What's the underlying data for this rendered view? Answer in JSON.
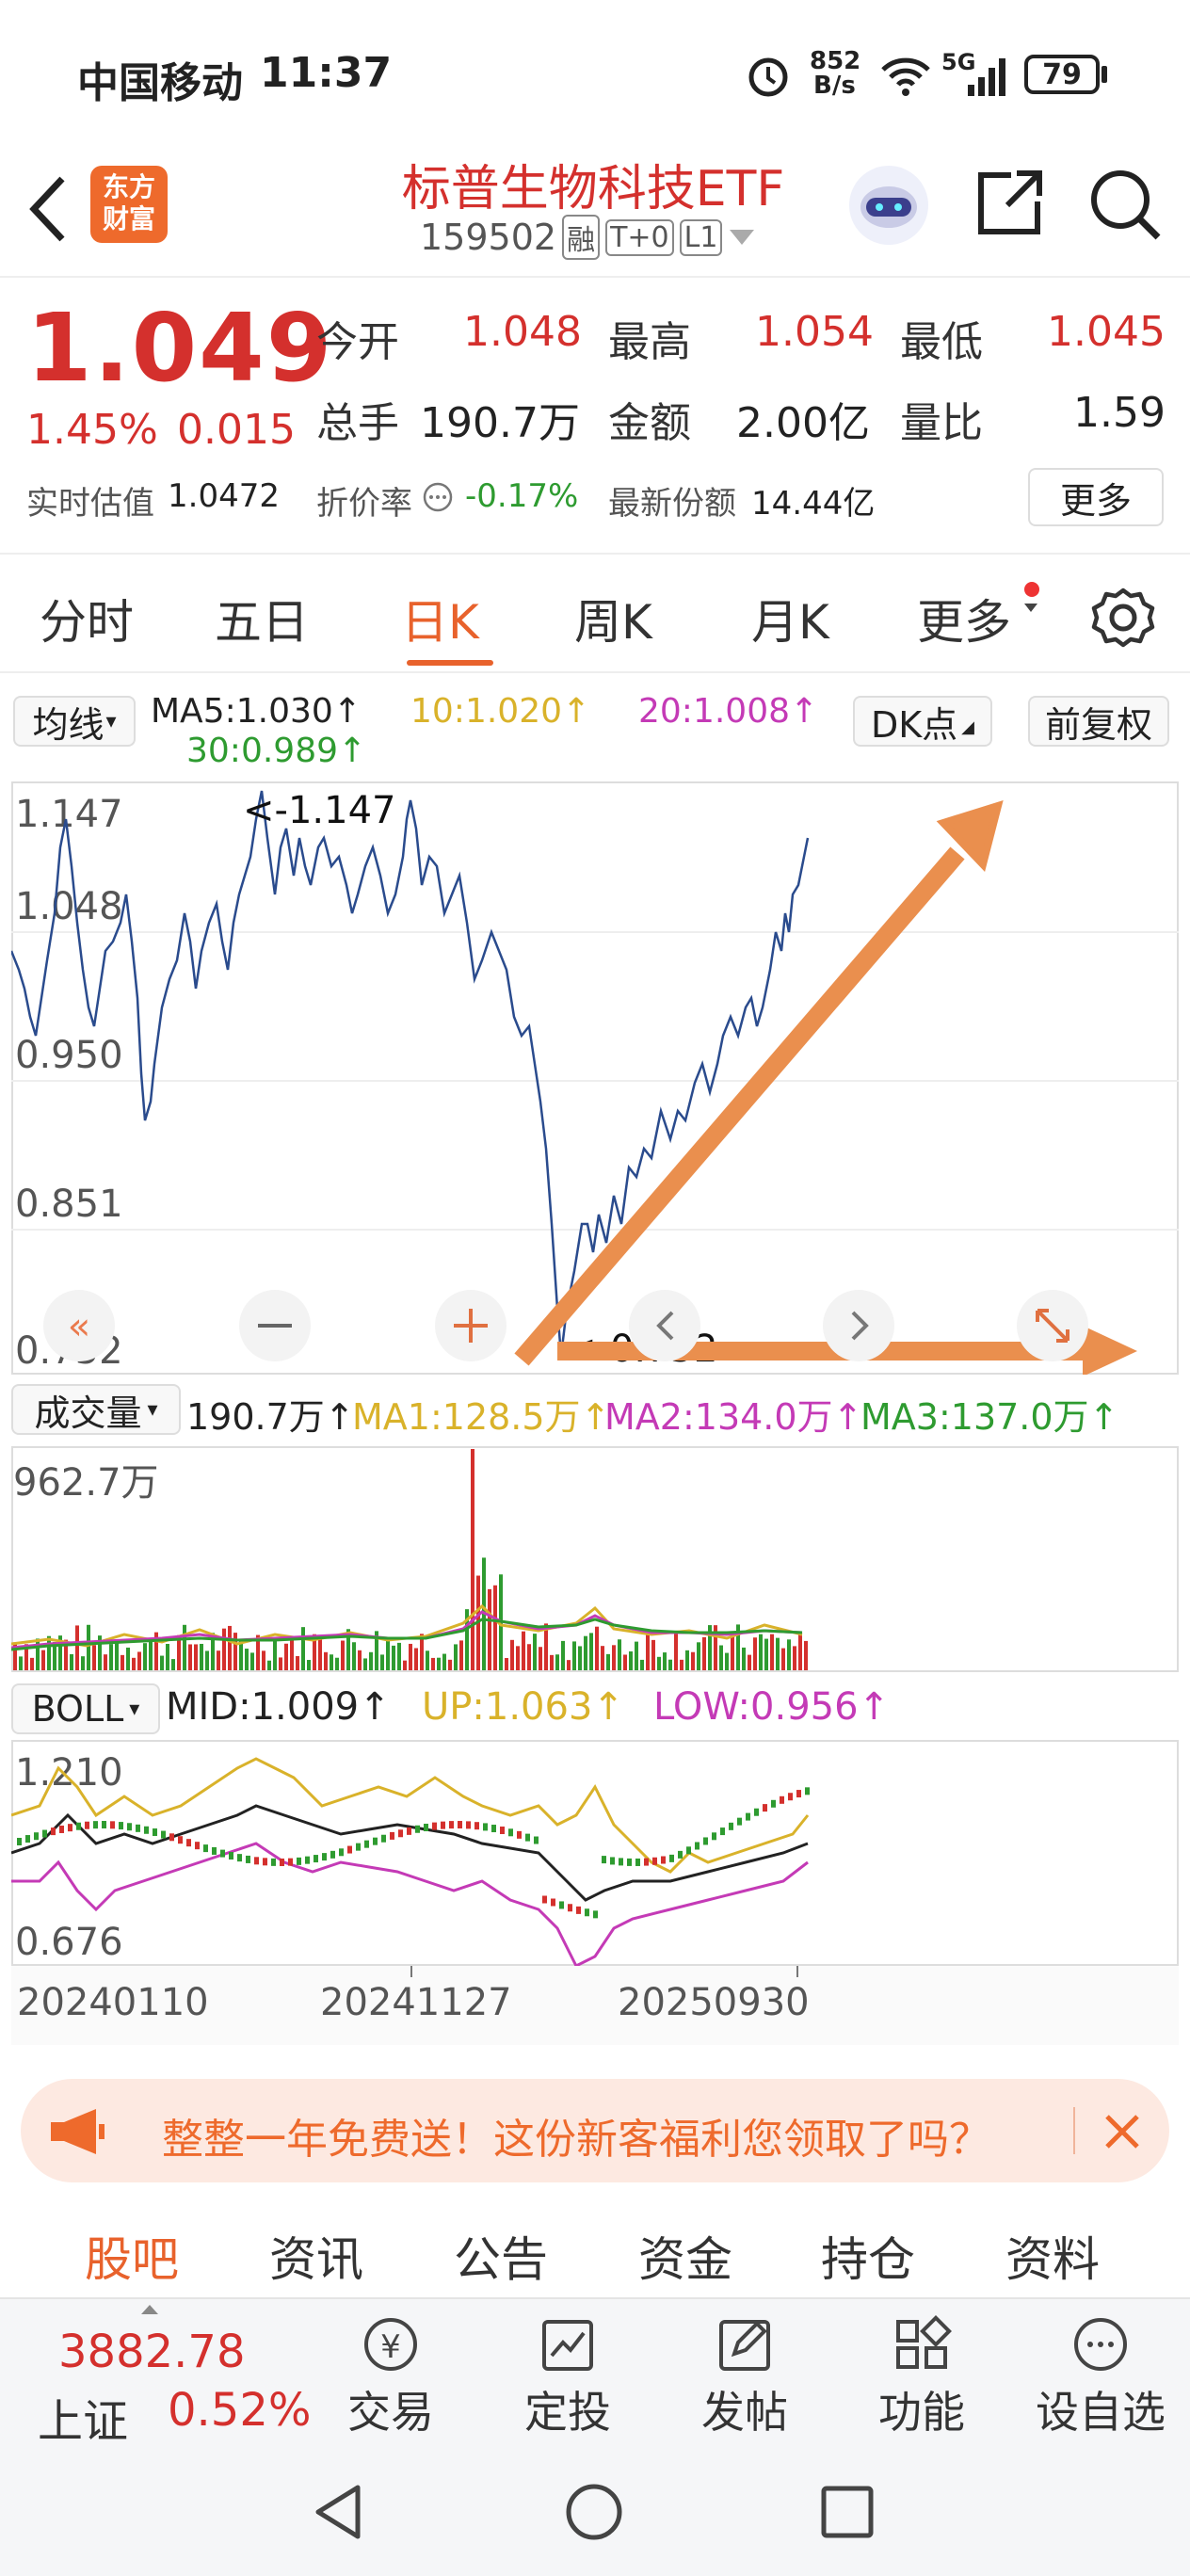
{
  "status": {
    "carrier": "中国移动",
    "time": "11:37",
    "net_speed_top": "852",
    "net_speed_bottom": "B/s",
    "signal": "5G",
    "battery": "79"
  },
  "header": {
    "logo_line1": "东方",
    "logo_line2": "财富",
    "title": "标普生物科技ETF",
    "code": "159502",
    "badges": [
      "融",
      "T+0",
      "L1"
    ]
  },
  "quote": {
    "price": "1.049",
    "change_pct": "1.45%",
    "change": "0.015",
    "open_label": "今开",
    "open": "1.048",
    "high_label": "最高",
    "high": "1.054",
    "low_label": "最低",
    "low": "1.045",
    "volume_label": "总手",
    "volume": "190.7万",
    "amount_label": "金额",
    "amount": "2.00亿",
    "ratio_label": "量比",
    "ratio": "1.59",
    "est_label": "实时估值",
    "est": "1.0472",
    "premium_label": "折价率",
    "premium": "-0.17%",
    "shares_label": "最新份额",
    "shares": "14.44亿",
    "more": "更多"
  },
  "periods": {
    "items": [
      "分时",
      "五日",
      "日K",
      "周K",
      "月K",
      "更多"
    ],
    "active": "日K"
  },
  "ma": {
    "selector": "均线",
    "ma5": "MA5:1.030↑",
    "ma10": "10:1.020↑",
    "ma20": "20:1.008↑",
    "ma30": "30:0.989↑",
    "dk": "DK点",
    "adjust": "前复权"
  },
  "kline": {
    "y_labels": [
      "1.147",
      "1.048",
      "0.950",
      "0.851",
      "0.752"
    ],
    "max_marker": "<-1.147",
    "min_marker": "<-0.752"
  },
  "volume_panel": {
    "selector": "成交量",
    "vol": "190.7万↑",
    "ma1": "MA1:128.5万↑",
    "ma2": "MA2:134.0万↑",
    "ma3": "MA3:137.0万↑",
    "max_label": "962.7万"
  },
  "boll_panel": {
    "selector": "BOLL",
    "mid": "MID:1.009↑",
    "up": "UP:1.063↑",
    "low": "LOW:0.956↑",
    "y_top": "1.210",
    "y_bottom": "0.676"
  },
  "dates": [
    "20240110",
    "20241127",
    "20250930"
  ],
  "banner": {
    "text": "整整一年免费送！这份新客福利您领取了吗？"
  },
  "info_tabs": {
    "items": [
      "股吧",
      "资讯",
      "公告",
      "资金",
      "持仓",
      "资料"
    ],
    "active": "股吧"
  },
  "bottom": {
    "index_value": "3882.78",
    "index_name": "上证",
    "index_change": "0.52%",
    "items": [
      "交易",
      "定投",
      "发帖",
      "功能",
      "设自选"
    ]
  },
  "colors": {
    "up": "#d4302d",
    "down": "#2e9b30",
    "accent": "#ee6a2c",
    "price_line": "#2a4b8d"
  }
}
